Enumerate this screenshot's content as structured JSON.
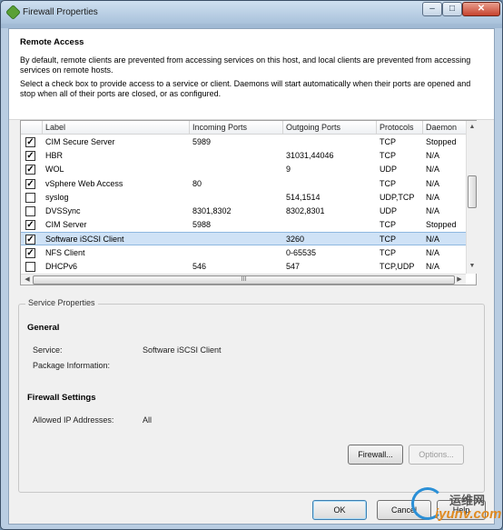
{
  "window": {
    "title": "Firewall Properties",
    "min_glyph": "–",
    "max_glyph": "□",
    "close_glyph": "✕"
  },
  "remote_access": {
    "title": "Remote Access",
    "desc1": "By default, remote clients are prevented from accessing services on this host, and local clients are prevented from accessing services on remote hosts.",
    "desc2": "Select a check box to provide access to a service or client. Daemons will start automatically when their ports are opened and stop when all of their ports are closed, or as configured."
  },
  "grid": {
    "columns": [
      "Label",
      "Incoming Ports",
      "Outgoing Ports",
      "Protocols",
      "Daemon"
    ],
    "rows": [
      {
        "checked": true,
        "label": "CIM Secure Server",
        "incoming": "5989",
        "outgoing": "",
        "protocols": "TCP",
        "daemon": "Stopped"
      },
      {
        "checked": true,
        "label": "HBR",
        "incoming": "",
        "outgoing": "31031,44046",
        "protocols": "TCP",
        "daemon": "N/A"
      },
      {
        "checked": true,
        "label": "WOL",
        "incoming": "",
        "outgoing": "9",
        "protocols": "UDP",
        "daemon": "N/A"
      },
      {
        "checked": true,
        "label": "vSphere Web Access",
        "incoming": "80",
        "outgoing": "",
        "protocols": "TCP",
        "daemon": "N/A"
      },
      {
        "checked": false,
        "label": "syslog",
        "incoming": "",
        "outgoing": "514,1514",
        "protocols": "UDP,TCP",
        "daemon": "N/A"
      },
      {
        "checked": false,
        "label": "DVSSync",
        "incoming": "8301,8302",
        "outgoing": "8302,8301",
        "protocols": "UDP",
        "daemon": "N/A"
      },
      {
        "checked": true,
        "label": "CIM Server",
        "incoming": "5988",
        "outgoing": "",
        "protocols": "TCP",
        "daemon": "Stopped"
      },
      {
        "checked": true,
        "label": "Software iSCSI Client",
        "incoming": "",
        "outgoing": "3260",
        "protocols": "TCP",
        "daemon": "N/A",
        "selected": true
      },
      {
        "checked": true,
        "label": "NFS Client",
        "incoming": "",
        "outgoing": "0-65535",
        "protocols": "TCP",
        "daemon": "N/A"
      },
      {
        "checked": false,
        "label": "DHCPv6",
        "incoming": "546",
        "outgoing": "547",
        "protocols": "TCP,UDP",
        "daemon": "N/A"
      }
    ],
    "hscroll_grip": "III"
  },
  "service_properties": {
    "legend": "Service Properties",
    "general_heading": "General",
    "service_label": "Service:",
    "service_value": "Software iSCSI Client",
    "package_label": "Package Information:",
    "package_value": "",
    "firewall_heading": "Firewall Settings",
    "allowed_label": "Allowed IP Addresses:",
    "allowed_value": "All"
  },
  "buttons": {
    "firewall": "Firewall...",
    "options": "Options...",
    "ok": "OK",
    "cancel": "Cancel",
    "help": "Help"
  },
  "watermark": {
    "cn": "运维网",
    "en": "iyunv.com"
  }
}
